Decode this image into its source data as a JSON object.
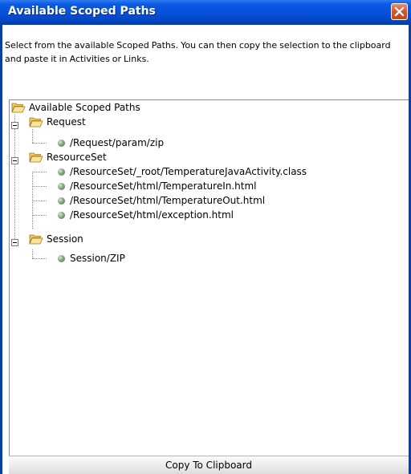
{
  "window": {
    "title": "Available Scoped Paths",
    "close_icon": "close-icon"
  },
  "instructions": "Select from the available Scoped Paths.  You can then copy the selection to the clipboard and paste it in Activities or Links.",
  "tree": {
    "root": {
      "label": "Available Scoped Paths",
      "icon": "folder-open-icon"
    },
    "groups": [
      {
        "label": "Request",
        "expanded": true,
        "children": [
          "/Request/param/zip"
        ]
      },
      {
        "label": "ResourceSet",
        "expanded": true,
        "children": [
          "/ResourceSet/_root/TemperatureJavaActivity.class",
          "/ResourceSet/html/TemperatureIn.html",
          "/ResourceSet/html/TemperatureOut.html",
          "/ResourceSet/html/exception.html"
        ]
      },
      {
        "label": "Session",
        "expanded": true,
        "children": [
          "Session/ZIP"
        ]
      }
    ]
  },
  "actions": {
    "copy_label": "Copy To Clipboard"
  },
  "colors": {
    "titlebar": "#0650d8",
    "window_border": "#0a3ea8",
    "close_button": "#d8582e",
    "folder": "#f5d26a",
    "leaf_dot": "#7fa87f"
  }
}
